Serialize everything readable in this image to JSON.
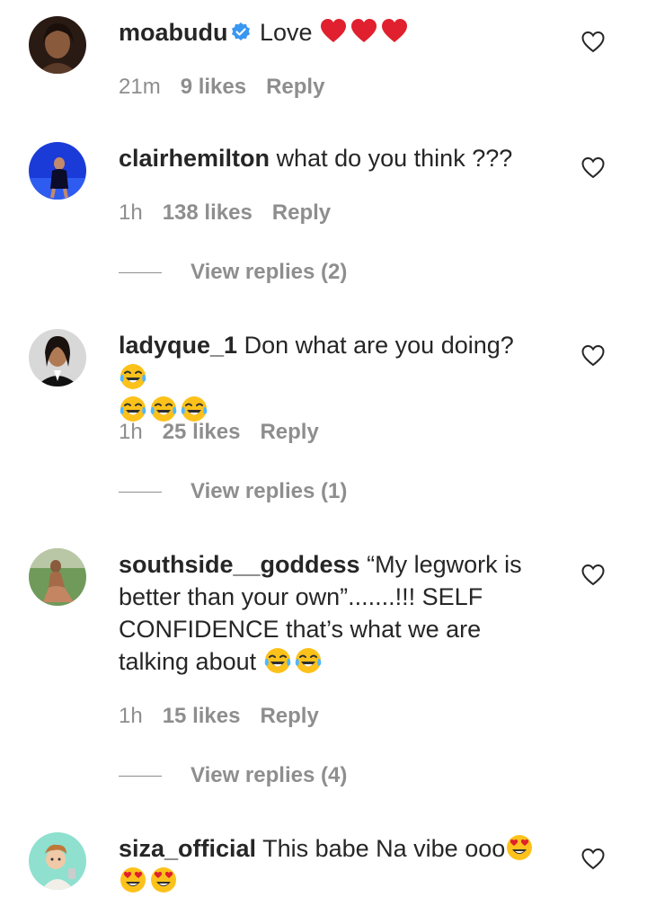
{
  "comments": [
    {
      "username": "moabudu",
      "verified": true,
      "text": "Love",
      "emojis": [
        "red-heart",
        "red-heart",
        "red-heart"
      ],
      "time": "21m",
      "likes": "9 likes",
      "reply": "Reply"
    },
    {
      "username": "clairhemilton",
      "verified": false,
      "text": "what do you think ???",
      "time": "1h",
      "likes": "138 likes",
      "reply": "Reply",
      "view_replies": "View replies (2)"
    },
    {
      "username": "ladyque_1",
      "verified": false,
      "text": "Don what are you doing?",
      "emojis": [
        "face-with-tears-of-joy",
        "face-with-tears-of-joy",
        "face-with-tears-of-joy",
        "face-with-tears-of-joy"
      ],
      "time": "1h",
      "likes": "25 likes",
      "reply": "Reply",
      "view_replies": "View replies (1)"
    },
    {
      "username": "southside__goddess",
      "verified": false,
      "text": "“My legwork is better than your own”.......!!! SELF CONFIDENCE that’s what we are talking about",
      "emojis": [
        "face-with-tears-of-joy",
        "face-with-tears-of-joy"
      ],
      "time": "1h",
      "likes": "15 likes",
      "reply": "Reply",
      "view_replies": "View replies (4)"
    },
    {
      "username": "siza_official",
      "verified": false,
      "text": "This babe Na vibe ooo",
      "emojis": [
        "smiling-face-with-heart-eyes",
        "smiling-face-with-heart-eyes",
        "smiling-face-with-heart-eyes"
      ]
    }
  ],
  "colors": {
    "text": "#262626",
    "secondary": "#8e8e8e",
    "verified_blue": "#3897f0",
    "heart_red": "#e0202e",
    "emoji_yellow": "#fcc21b"
  }
}
